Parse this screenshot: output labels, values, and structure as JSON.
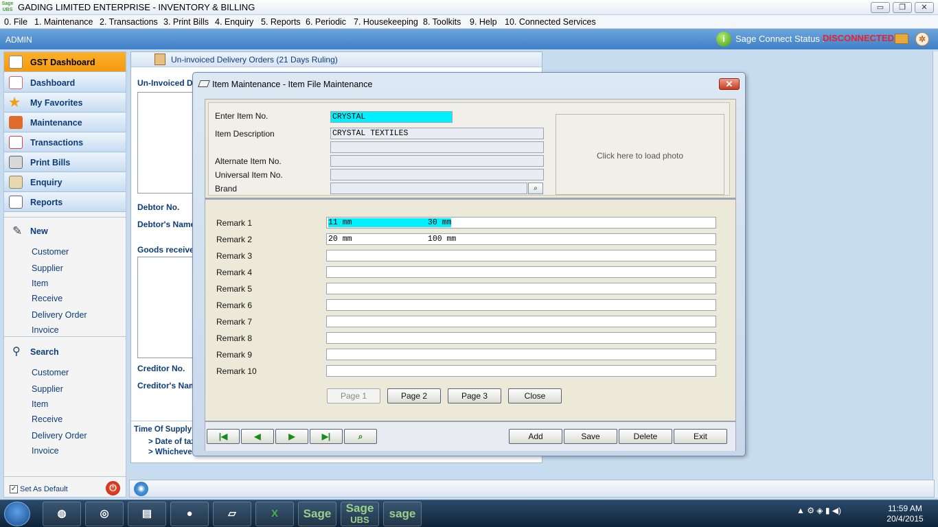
{
  "window": {
    "logo_top": "Sage",
    "logo_bottom": "UBS",
    "title": "GADING LIMITED ENTERPRISE - INVENTORY & BILLING",
    "minimize": "▭",
    "restore": "❐",
    "close": "✕"
  },
  "menu": [
    "0. File",
    "1. Maintenance",
    "2. Transactions",
    "3. Print Bills",
    "4. Enquiry",
    "5. Reports",
    "6. Periodic",
    "7. Housekeeping",
    "8. Toolkits",
    "9. Help",
    "10. Connected Services"
  ],
  "statusbar": {
    "user": "ADMIN",
    "connect_label": "Sage Connect Status :",
    "connect_status": "DISCONNECTED",
    "status_color": "#e8202a",
    "info_glyph": "i",
    "tools_glyph": "✲"
  },
  "sidebar": {
    "nav": [
      "GST Dashboard",
      "Dashboard",
      "My Favorites",
      "Maintenance",
      "Transactions",
      "Print Bills",
      "Enquiry",
      "Reports"
    ],
    "new_title": "New",
    "new_items": [
      "Customer",
      "Supplier",
      "Item",
      "Receive",
      "Delivery Order",
      "Invoice"
    ],
    "search_title": "Search",
    "search_items": [
      "Customer",
      "Supplier",
      "Item",
      "Receive",
      "Delivery Order",
      "Invoice"
    ],
    "set_default": "Set As Default",
    "set_default_checked": "✓",
    "power_glyph": "⏻"
  },
  "background": {
    "header": "Un-invoiced Delivery Orders (21 Days Ruling)",
    "uninvoiced": "Un-Invoiced De",
    "debtor_no": "Debtor No.",
    "debtor_name": "Debtor's Name",
    "goods": "Goods receive",
    "creditor_no": "Creditor No.",
    "creditor_name": "Creditor's Nam",
    "time_supply": "Time Of Supply",
    "date_tax": "> Date of tax",
    "whichever": "> Whicheve"
  },
  "dialog": {
    "title": "Item Maintenance - Item File Maintenance",
    "close": "✕",
    "enter_item_label": "Enter Item No.",
    "enter_item_value": "CRYSTAL",
    "desc_label": "Item Description",
    "desc_value": "CRYSTAL TEXTILES",
    "desc_value2": "",
    "alt_label": "Alternate Item No.",
    "alt_value": "",
    "univ_label": "Universal Item No.",
    "univ_value": "",
    "brand_label": "Brand",
    "brand_value": "",
    "brand_btn": "⌕",
    "photo": "Click here to load photo",
    "remarks": [
      {
        "label": "Remark 1",
        "value": "11 mm                30 mm"
      },
      {
        "label": "Remark 2",
        "value": "20 mm                100 mm"
      },
      {
        "label": "Remark 3",
        "value": ""
      },
      {
        "label": "Remark 4",
        "value": ""
      },
      {
        "label": "Remark 5",
        "value": ""
      },
      {
        "label": "Remark 6",
        "value": ""
      },
      {
        "label": "Remark 7",
        "value": ""
      },
      {
        "label": "Remark 8",
        "value": ""
      },
      {
        "label": "Remark 9",
        "value": ""
      },
      {
        "label": "Remark 10",
        "value": ""
      }
    ],
    "page1": "Page 1",
    "page2": "Page 2",
    "page3": "Page 3",
    "close_btn": "Close",
    "nav_first": "|◀",
    "nav_prev": "◀",
    "nav_next": "▶",
    "nav_last": "▶|",
    "nav_find": "⌕",
    "add": "Add",
    "save": "Save",
    "delete": "Delete",
    "exit": "Exit"
  },
  "taskbar": {
    "sage1": "Sage",
    "sage2": "Sage",
    "sage2_sub": "UBS",
    "sage3": "sage",
    "excel": "X",
    "tray": "▲  ⚙  ◈  ▮  ◀)",
    "time": "11:59 AM",
    "date": "20/4/2015"
  }
}
